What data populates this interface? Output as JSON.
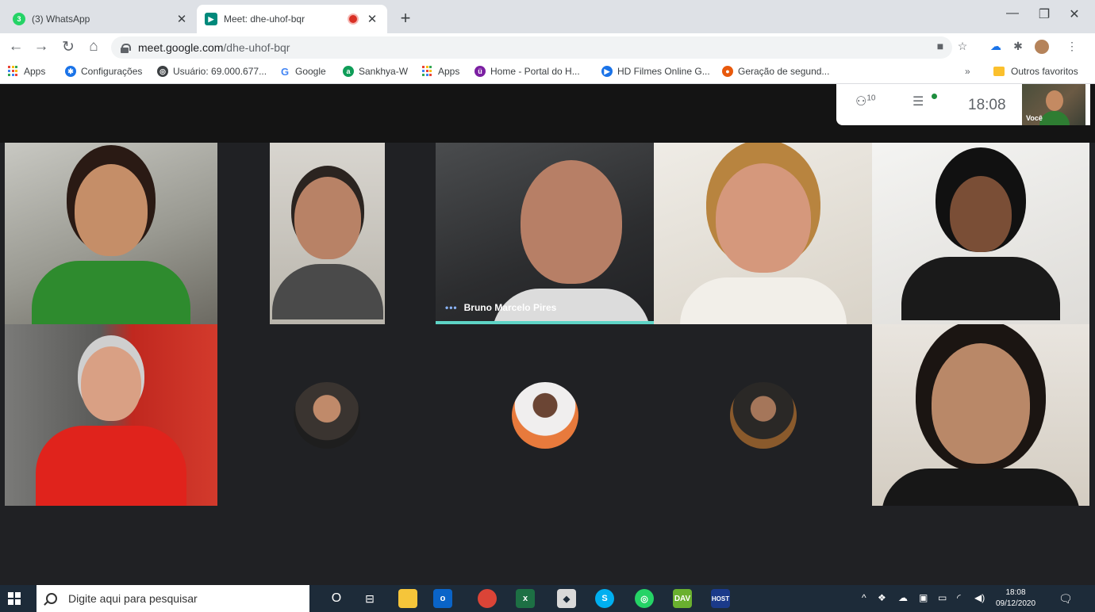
{
  "browser": {
    "tabs": [
      {
        "title": "(3) WhatsApp",
        "favicon": "whatsapp-icon",
        "color": "#25d366",
        "active": false
      },
      {
        "title": "Meet: dhe-uhof-bqr",
        "favicon": "meet-icon",
        "color": "#00897b",
        "active": true,
        "recording": true
      }
    ],
    "url_host": "meet.google.com",
    "url_path": "/dhe-uhof-bqr",
    "bookmarks": [
      {
        "label": "Apps",
        "icon": "apps-grid-icon"
      },
      {
        "label": "Configurações",
        "icon": "gear-icon",
        "color": "#1a73e8"
      },
      {
        "label": "Usuário: 69.000.677...",
        "icon": "globe-icon",
        "color": "#3c4043"
      },
      {
        "label": "Google",
        "icon": "google-icon",
        "color": "#4285f4"
      },
      {
        "label": "Sankhya-W",
        "icon": "sankhya-icon",
        "color": "#0f9d58"
      },
      {
        "label": "Apps",
        "icon": "apps-grid-icon"
      },
      {
        "label": "Home - Portal do H...",
        "icon": "portal-icon",
        "color": "#7b1fa2"
      },
      {
        "label": "HD Filmes Online G...",
        "icon": "play-icon",
        "color": "#1a73e8"
      },
      {
        "label": "Geração de segund...",
        "icon": "firefox-icon",
        "color": "#e8590c"
      }
    ],
    "bookmarks_overflow": "»",
    "other_bookmarks": "Outros favoritos"
  },
  "meet": {
    "people_count": "10",
    "time": "18:08",
    "self_label": "Você",
    "active_speaker": "Bruno Marcelo Pires"
  },
  "taskbar": {
    "search_placeholder": "Digite aqui para pesquisar",
    "apps": [
      {
        "name": "cortana-icon",
        "label": "O"
      },
      {
        "name": "task-view-icon",
        "label": "⊟"
      },
      {
        "name": "file-explorer-icon",
        "label": ""
      },
      {
        "name": "outlook-icon",
        "label": "o"
      },
      {
        "name": "chrome-icon",
        "label": ""
      },
      {
        "name": "excel-icon",
        "label": "x"
      },
      {
        "name": "vs-icon",
        "label": "◆"
      },
      {
        "name": "skype-icon",
        "label": "S"
      },
      {
        "name": "whatsapp-icon",
        "label": "◎"
      },
      {
        "name": "dav-icon",
        "label": "DAV"
      },
      {
        "name": "host-icon",
        "label": "HOST"
      }
    ],
    "clock_time": "18:08",
    "clock_date": "09/12/2020"
  }
}
